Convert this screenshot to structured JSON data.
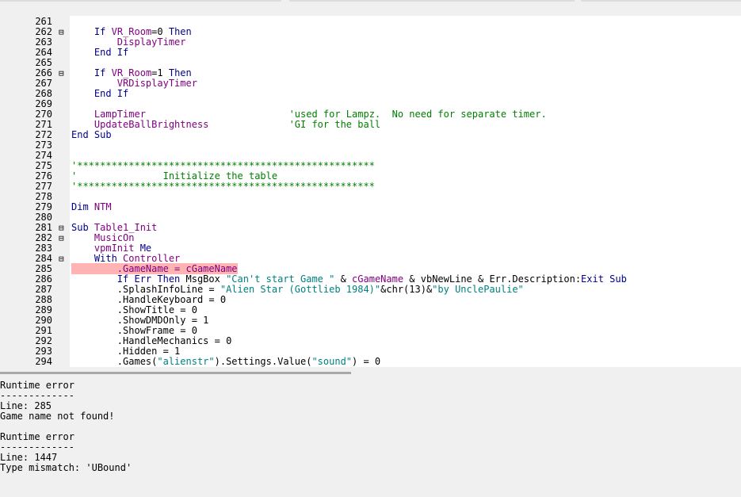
{
  "editor": {
    "lines": [
      {
        "num": "261",
        "fold": "",
        "hl": false,
        "segs": []
      },
      {
        "num": "262",
        "fold": "⊟",
        "hl": false,
        "segs": [
          [
            "pl",
            "    "
          ],
          [
            "kw",
            "If "
          ],
          [
            "id",
            "VR_Room"
          ],
          [
            "pl",
            "=0 "
          ],
          [
            "kw",
            "Then"
          ]
        ]
      },
      {
        "num": "263",
        "fold": "",
        "hl": false,
        "segs": [
          [
            "pl",
            "        "
          ],
          [
            "id",
            "DisplayTimer"
          ]
        ]
      },
      {
        "num": "264",
        "fold": "",
        "hl": false,
        "segs": [
          [
            "pl",
            "    "
          ],
          [
            "kw",
            "End If"
          ]
        ]
      },
      {
        "num": "265",
        "fold": "",
        "hl": false,
        "segs": []
      },
      {
        "num": "266",
        "fold": "⊟",
        "hl": false,
        "segs": [
          [
            "pl",
            "    "
          ],
          [
            "kw",
            "If "
          ],
          [
            "id",
            "VR_Room"
          ],
          [
            "pl",
            "=1 "
          ],
          [
            "kw",
            "Then"
          ]
        ]
      },
      {
        "num": "267",
        "fold": "",
        "hl": false,
        "segs": [
          [
            "pl",
            "        "
          ],
          [
            "id",
            "VRDisplayTimer"
          ]
        ]
      },
      {
        "num": "268",
        "fold": "",
        "hl": false,
        "segs": [
          [
            "pl",
            "    "
          ],
          [
            "kw",
            "End If"
          ]
        ]
      },
      {
        "num": "269",
        "fold": "",
        "hl": false,
        "segs": []
      },
      {
        "num": "270",
        "fold": "",
        "hl": false,
        "segs": [
          [
            "pl",
            "    "
          ],
          [
            "id",
            "LampTimer"
          ],
          [
            "pl",
            "                         "
          ],
          [
            "cm",
            "'used for Lampz.  No need for separate timer."
          ]
        ]
      },
      {
        "num": "271",
        "fold": "",
        "hl": false,
        "segs": [
          [
            "pl",
            "    "
          ],
          [
            "id",
            "UpdateBallBrightness"
          ],
          [
            "pl",
            "              "
          ],
          [
            "cm",
            "'GI for the ball"
          ]
        ]
      },
      {
        "num": "272",
        "fold": "",
        "hl": false,
        "segs": [
          [
            "kw",
            "End Sub"
          ]
        ]
      },
      {
        "num": "273",
        "fold": "",
        "hl": false,
        "segs": []
      },
      {
        "num": "274",
        "fold": "",
        "hl": false,
        "segs": []
      },
      {
        "num": "275",
        "fold": "",
        "hl": false,
        "segs": [
          [
            "cm",
            "'****************************************************"
          ]
        ]
      },
      {
        "num": "276",
        "fold": "",
        "hl": false,
        "segs": [
          [
            "cm",
            "'               Initialize the table"
          ]
        ]
      },
      {
        "num": "277",
        "fold": "",
        "hl": false,
        "segs": [
          [
            "cm",
            "'****************************************************"
          ]
        ]
      },
      {
        "num": "278",
        "fold": "",
        "hl": false,
        "segs": []
      },
      {
        "num": "279",
        "fold": "",
        "hl": false,
        "segs": [
          [
            "kw",
            "Dim "
          ],
          [
            "id",
            "NTM"
          ]
        ]
      },
      {
        "num": "280",
        "fold": "",
        "hl": false,
        "segs": []
      },
      {
        "num": "281",
        "fold": "⊟",
        "hl": false,
        "segs": [
          [
            "kw",
            "Sub "
          ],
          [
            "id",
            "Table1_Init"
          ]
        ]
      },
      {
        "num": "282",
        "fold": "⊟",
        "hl": false,
        "segs": [
          [
            "pl",
            "    "
          ],
          [
            "id",
            "MusicOn"
          ]
        ]
      },
      {
        "num": "283",
        "fold": "",
        "hl": false,
        "segs": [
          [
            "pl",
            "    "
          ],
          [
            "id",
            "vpmInit "
          ],
          [
            "kw",
            "Me"
          ]
        ]
      },
      {
        "num": "284",
        "fold": "⊟",
        "hl": false,
        "segs": [
          [
            "pl",
            "    "
          ],
          [
            "kw",
            "With "
          ],
          [
            "id",
            "Controller"
          ]
        ]
      },
      {
        "num": "285",
        "fold": "",
        "hl": true,
        "segs": [
          [
            "pl",
            "        "
          ],
          [
            "id",
            ".GameName = cGameName"
          ]
        ]
      },
      {
        "num": "286",
        "fold": "",
        "hl": false,
        "segs": [
          [
            "pl",
            "        "
          ],
          [
            "kw",
            "If Err Then "
          ],
          [
            "pl",
            "MsgBox "
          ],
          [
            "str",
            "\"Can't start Game \""
          ],
          [
            "pl",
            " & "
          ],
          [
            "id",
            "cGameName"
          ],
          [
            "pl",
            " & vbNewLine & Err.Description:"
          ],
          [
            "kw",
            "Exit Sub"
          ]
        ]
      },
      {
        "num": "287",
        "fold": "",
        "hl": false,
        "segs": [
          [
            "pl",
            "        .SplashInfoLine = "
          ],
          [
            "str",
            "\"Alien Star (Gottlieb 1984)\""
          ],
          [
            "pl",
            "&chr(13)&"
          ],
          [
            "str",
            "\"by UnclePaulie\""
          ]
        ]
      },
      {
        "num": "288",
        "fold": "",
        "hl": false,
        "segs": [
          [
            "pl",
            "        .HandleKeyboard = 0"
          ]
        ]
      },
      {
        "num": "289",
        "fold": "",
        "hl": false,
        "segs": [
          [
            "pl",
            "        .ShowTitle = 0"
          ]
        ]
      },
      {
        "num": "290",
        "fold": "",
        "hl": false,
        "segs": [
          [
            "pl",
            "        .ShowDMDOnly = 1"
          ]
        ]
      },
      {
        "num": "291",
        "fold": "",
        "hl": false,
        "segs": [
          [
            "pl",
            "        .ShowFrame = 0"
          ]
        ]
      },
      {
        "num": "292",
        "fold": "",
        "hl": false,
        "segs": [
          [
            "pl",
            "        .HandleMechanics = 0"
          ]
        ]
      },
      {
        "num": "293",
        "fold": "",
        "hl": false,
        "segs": [
          [
            "pl",
            "        .Hidden = 1"
          ]
        ]
      },
      {
        "num": "294",
        "fold": "",
        "hl": false,
        "segs": [
          [
            "pl",
            "        .Games("
          ],
          [
            "str",
            "\"alienstr\""
          ],
          [
            "pl",
            ").Settings.Value("
          ],
          [
            "str",
            "\"sound\""
          ],
          [
            "pl",
            ") = 0"
          ]
        ]
      }
    ]
  },
  "output": {
    "lines": [
      "Runtime error",
      "-------------",
      "Line: 285",
      "Game name not found!",
      "",
      "Runtime error",
      "-------------",
      "Line: 1447",
      "Type mismatch: 'UBound'"
    ]
  },
  "colors": {
    "keyword": "#00008b",
    "identifier": "#800080",
    "string": "#008080",
    "comment": "#008000",
    "error_highlight": "#ffb3b3"
  }
}
